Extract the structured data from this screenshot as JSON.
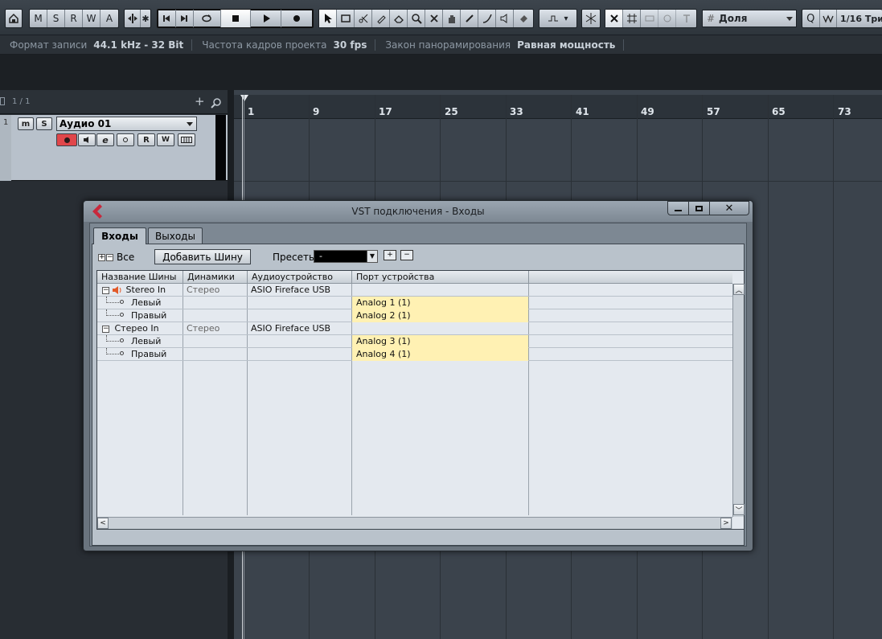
{
  "toolbar": {
    "mode_buttons": [
      "M",
      "S",
      "R",
      "W",
      "A"
    ],
    "snap_mode": "Доля",
    "quantize_label": "Q",
    "quantize_value": "1/16",
    "quantize_type": "Трио"
  },
  "infobar": {
    "items": [
      {
        "label": "Формат записи",
        "value": "44.1 kHz - 32 Bit"
      },
      {
        "label": "Частота кадров проекта",
        "value": "30 fps"
      },
      {
        "label": "Закон панорамирования",
        "value": "Равная мощность"
      }
    ]
  },
  "track_list": {
    "counter": "1 / 1",
    "tracks": [
      {
        "number": "1",
        "name": "Аудио 01",
        "mute": "m",
        "solo": "S",
        "read": "R",
        "write": "W"
      }
    ]
  },
  "ruler": {
    "bars": [
      "1",
      "9",
      "17",
      "25",
      "33",
      "41",
      "49",
      "57",
      "65",
      "73"
    ]
  },
  "dialog": {
    "title": "VST подключения - Входы",
    "tabs": [
      {
        "label": "Входы",
        "active": true
      },
      {
        "label": "Выходы",
        "active": false
      }
    ],
    "expand_all_label": "Все",
    "add_bus_label": "Добавить Шину",
    "presets_label": "Пресеты",
    "presets_value": "-",
    "columns": [
      "Название Шины",
      "Динамики",
      "Аудиоустройство",
      "Порт устройства"
    ],
    "rows": [
      {
        "name": "Stereo In",
        "speakers": "Стерео",
        "device": "ASIO Fireface USB",
        "port": "",
        "level": 0
      },
      {
        "name": "Левый",
        "speakers": "",
        "device": "",
        "port": "Analog 1 (1)",
        "level": 1
      },
      {
        "name": "Правый",
        "speakers": "",
        "device": "",
        "port": "Analog 2 (1)",
        "level": 1
      },
      {
        "name": "Стерео In",
        "speakers": "Стерео",
        "device": "ASIO Fireface USB",
        "port": "",
        "level": 0
      },
      {
        "name": "Левый",
        "speakers": "",
        "device": "",
        "port": "Analog 3 (1)",
        "level": 1
      },
      {
        "name": "Правый",
        "speakers": "",
        "device": "",
        "port": "Analog 4 (1)",
        "level": 1
      }
    ],
    "colors": {
      "port_highlight": "#fff1b3",
      "record_active": "#e0464a"
    }
  }
}
